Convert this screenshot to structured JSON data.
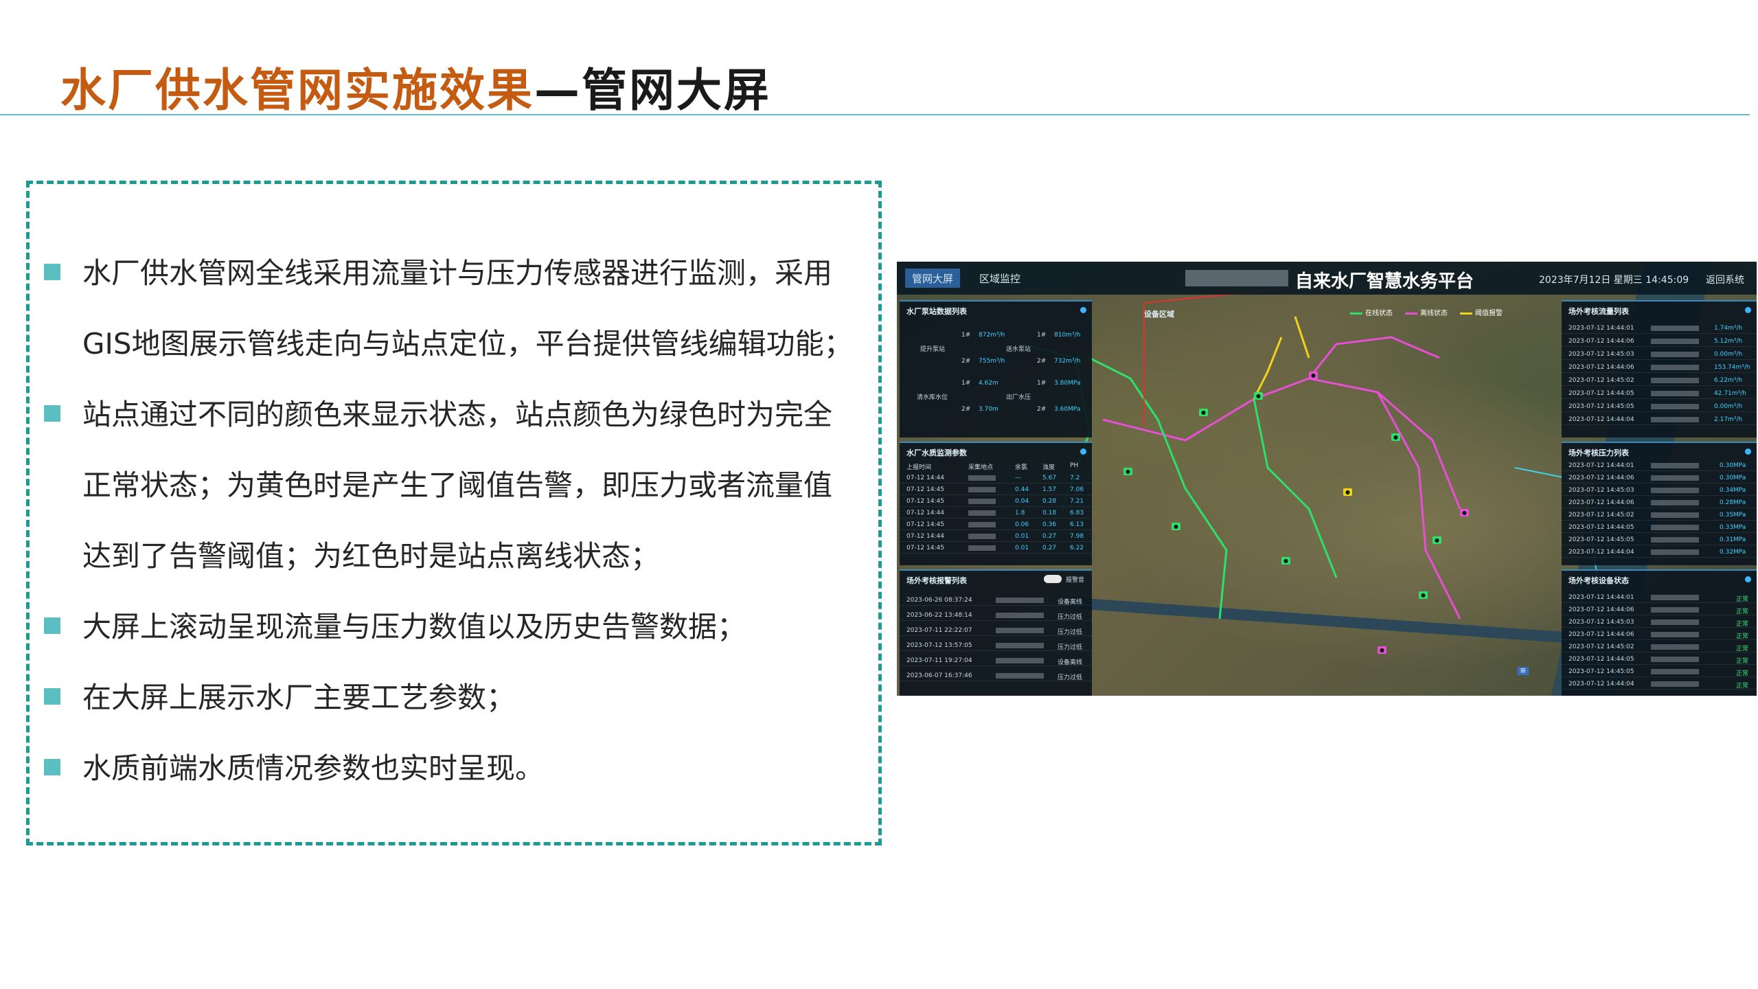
{
  "slide": {
    "title_orange": "水厂供水管网实施效果",
    "title_black": "—管网大屏"
  },
  "bullets": [
    "水厂供水管网全线采用流量计与压力传感器进行监测，采用GIS地图展示管线走向与站点定位，平台提供管线编辑功能；",
    "站点通过不同的颜色来显示状态，站点颜色为绿色时为完全正常状态；为黄色时是产生了阈值告警，即压力或者流量值达到了告警阈值；为红色时是站点离线状态；",
    "大屏上滚动呈现流量与压力数值以及历史告警数据；",
    "在大屏上展示水厂主要工艺参数；",
    "水质前端水质情况参数也实时呈现。"
  ],
  "dashboard": {
    "nav": {
      "btn1": "管网大屏",
      "btn2": "区域监控"
    },
    "platform_title": "自来水厂智慧水务平台",
    "datetime": "2023年7月12日  星期三  14:45:09",
    "back": "返回系统",
    "device_area": "设备区域",
    "legend": {
      "online": "在线状态",
      "offline": "离线状态",
      "alarm": "阈值报警"
    },
    "colors": {
      "online": "#2ee06b",
      "offline": "#e94fd6",
      "alarm": "#f2d21b",
      "accent": "#3fb4ff"
    },
    "panels": {
      "pump_list": {
        "title": "水厂泵站数据列表",
        "rows": [
          {
            "no": "1#",
            "val1": "872m³/h",
            "no2": "1#",
            "val2": "810m³/h"
          },
          {
            "label1": "提升泵站",
            "label2": "送水泵站"
          },
          {
            "no": "2#",
            "val1": "755m³/h",
            "no2": "2#",
            "val2": "732m³/h"
          },
          {
            "no": "1#",
            "val1": "4.62m",
            "no2": "1#",
            "val2": "3.80MPa"
          },
          {
            "label1": "清水库水位",
            "label2": "出厂水压"
          },
          {
            "no": "2#",
            "val1": "3.70m",
            "no2": "2#",
            "val2": "3.60MPa"
          }
        ]
      },
      "water_quality": {
        "title": "水厂水质监测参数",
        "headers": [
          "上报时间",
          "采集地点",
          "余氯",
          "浊度",
          "PH"
        ],
        "rows": [
          [
            "07-12 14:44",
            "",
            "—",
            "5.67",
            "7.2"
          ],
          [
            "07-12 14:45",
            "",
            "0.44",
            "1.57",
            "7.06"
          ],
          [
            "07-12 14:45",
            "",
            "0.04",
            "0.28",
            "7.21"
          ],
          [
            "07-12 14:44",
            "",
            "1.8",
            "0.18",
            "6.83"
          ],
          [
            "07-12 14:45",
            "",
            "0.06",
            "0.36",
            "6.13"
          ],
          [
            "07-12 14:44",
            "",
            "0.01",
            "0.27",
            "7.98"
          ],
          [
            "07-12 14:45",
            "",
            "0.01",
            "0.27",
            "6.22"
          ]
        ]
      },
      "alarm_list": {
        "title": "场外考核报警列表",
        "toggle_label": "报警音",
        "rows": [
          [
            "2023-06-26 08:37:24",
            "",
            "设备离线"
          ],
          [
            "2023-06-22 13:48:14",
            "",
            "压力过低"
          ],
          [
            "2023-07-11 22:22:07",
            "",
            "压力过低"
          ],
          [
            "2023-07-12 13:57:05",
            "",
            "压力过低"
          ],
          [
            "2023-07-11 19:27:04",
            "",
            "设备离线"
          ],
          [
            "2023-06-07 16:37:46",
            "",
            "压力过低"
          ]
        ]
      },
      "flow_list": {
        "title": "场外考核流量列表",
        "rows": [
          [
            "2023-07-12 14:44:01",
            "1.74m³/h"
          ],
          [
            "2023-07-12 14:44:06",
            "5.12m³/h"
          ],
          [
            "2023-07-12 14:45:03",
            "0.00m³/h"
          ],
          [
            "2023-07-12 14:44:06",
            "153.74m³/h"
          ],
          [
            "2023-07-12 14:45:02",
            "6.22m³/h"
          ],
          [
            "2023-07-12 14:44:05",
            "42.71m³/h"
          ],
          [
            "2023-07-12 14:45:05",
            "0.00m³/h"
          ],
          [
            "2023-07-12 14:44:04",
            "2.17m³/h"
          ]
        ]
      },
      "pressure_list": {
        "title": "场外考核压力列表",
        "rows": [
          [
            "2023-07-12 14:44:01",
            "0.30MPa"
          ],
          [
            "2023-07-12 14:44:06",
            "0.30MPa"
          ],
          [
            "2023-07-12 14:45:03",
            "0.34MPa"
          ],
          [
            "2023-07-12 14:44:06",
            "0.28MPa"
          ],
          [
            "2023-07-12 14:45:02",
            "0.35MPa"
          ],
          [
            "2023-07-12 14:44:05",
            "0.33MPa"
          ],
          [
            "2023-07-12 14:45:05",
            "0.31MPa"
          ],
          [
            "2023-07-12 14:44:04",
            "0.32MPa"
          ]
        ]
      },
      "device_status": {
        "title": "场外考核设备状态",
        "rows": [
          [
            "2023-07-12 14:44:01",
            "正常"
          ],
          [
            "2023-07-12 14:44:06",
            "正常"
          ],
          [
            "2023-07-12 14:45:03",
            "正常"
          ],
          [
            "2023-07-12 14:44:06",
            "正常"
          ],
          [
            "2023-07-12 14:45:02",
            "正常"
          ],
          [
            "2023-07-12 14:44:05",
            "正常"
          ],
          [
            "2023-07-12 14:45:05",
            "正常"
          ],
          [
            "2023-07-12 14:44:04",
            "正常"
          ]
        ]
      }
    }
  }
}
